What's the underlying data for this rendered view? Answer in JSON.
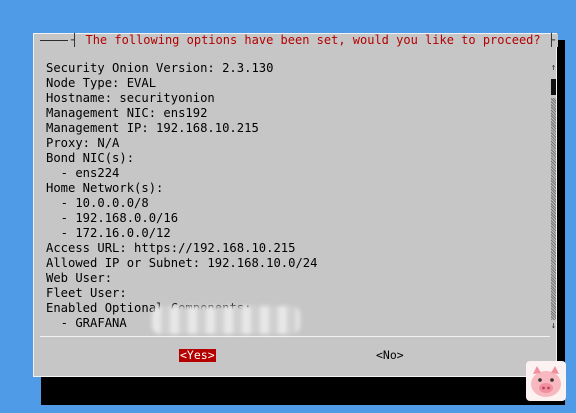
{
  "dialog": {
    "title": "The following options have been set, would you like to proceed?",
    "lines": [
      "Security Onion Version: 2.3.130",
      "Node Type: EVAL",
      "Hostname: securityonion",
      "Management NIC: ens192",
      "Management IP: 192.168.10.215",
      "Proxy: N/A",
      "Bond NIC(s):",
      "  - ens224",
      "Home Network(s):",
      "  - 10.0.0.0/8",
      "  - 192.168.0.0/16",
      "  - 172.16.0.0/12",
      "Access URL: https://192.168.10.215",
      "Allowed IP or Subnet: 192.168.10.0/24",
      "Web User:",
      "Fleet User:",
      "Enabled Optional Components:",
      "  - GRAFANA"
    ],
    "scroll_up": "↑",
    "scroll_down": "↓",
    "yes_label": "<Yes>",
    "no_label": "<No>"
  },
  "colors": {
    "background": "#4f9be8",
    "dialog": "#c6c6c6",
    "title": "#b40000",
    "selected_button": "#b40000"
  }
}
